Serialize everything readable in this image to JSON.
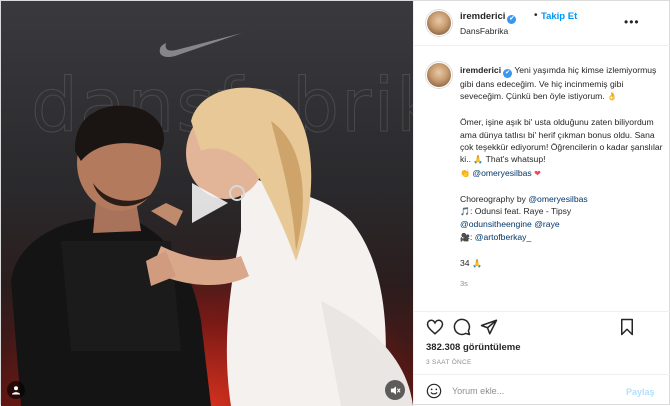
{
  "media": {
    "wall_text": "dansfabrika"
  },
  "post": {
    "username": "iremderici",
    "verified_mark": "✔",
    "dot": "•",
    "follow_label": "Takip Et",
    "location": "DansFabrika",
    "more_icon": "•••"
  },
  "caption": {
    "username": "iremderici",
    "p1": "Yeni yaşımda hiç kimse izlemiyormuş gibi dans edeceğim. Ve hiç incinmemiş gibi seveceğim. Çünkü ben öyle istiyorum.",
    "p1_emoji": "👌",
    "p2_text": "Ömer, işine aşık bi' usta olduğunu zaten biliyordum ama dünya tatlısı bi' herif çıkman bonus oldu. Sana çok teşekkür ediyorum! Öğrencilerin o kadar şanslılar ki..",
    "p2_emoji": "🙏",
    "p2_tail": "That's whatsup!",
    "p2_mention_emoji": "👏",
    "p2_mention": "@omeryesilbas",
    "p2_heart": "❤",
    "choreo_label": "Choreography by",
    "choreo_mention": "@omeryesilbas",
    "music_emoji": "🎵",
    "music_text": ": Odunsi feat. Raye - Tipsy",
    "music_mention1": "@odunsitheengine",
    "music_mention2": "@raye",
    "camera_emoji": "🎥",
    "camera_prefix": ":",
    "camera_mention": "@artofberkay_",
    "count": "34",
    "count_emoji": "🙏",
    "time": "3s"
  },
  "stats": {
    "views": "382.308 görüntüleme",
    "time_ago": "3 SAAT ÖNCE"
  },
  "comment_box": {
    "placeholder": "Yorum ekle...",
    "share_label": "Paylaş"
  },
  "icons": {
    "like": "heart-outline-icon",
    "comment": "comment-icon",
    "share": "paper-plane-icon",
    "save": "bookmark-icon",
    "play": "play-icon",
    "mute": "muted-speaker-icon",
    "emoji": "smiley-icon"
  },
  "colors": {
    "link": "#0095f6",
    "mention": "#00376b",
    "verified": "#3897f0",
    "heart": "#ed4956"
  }
}
